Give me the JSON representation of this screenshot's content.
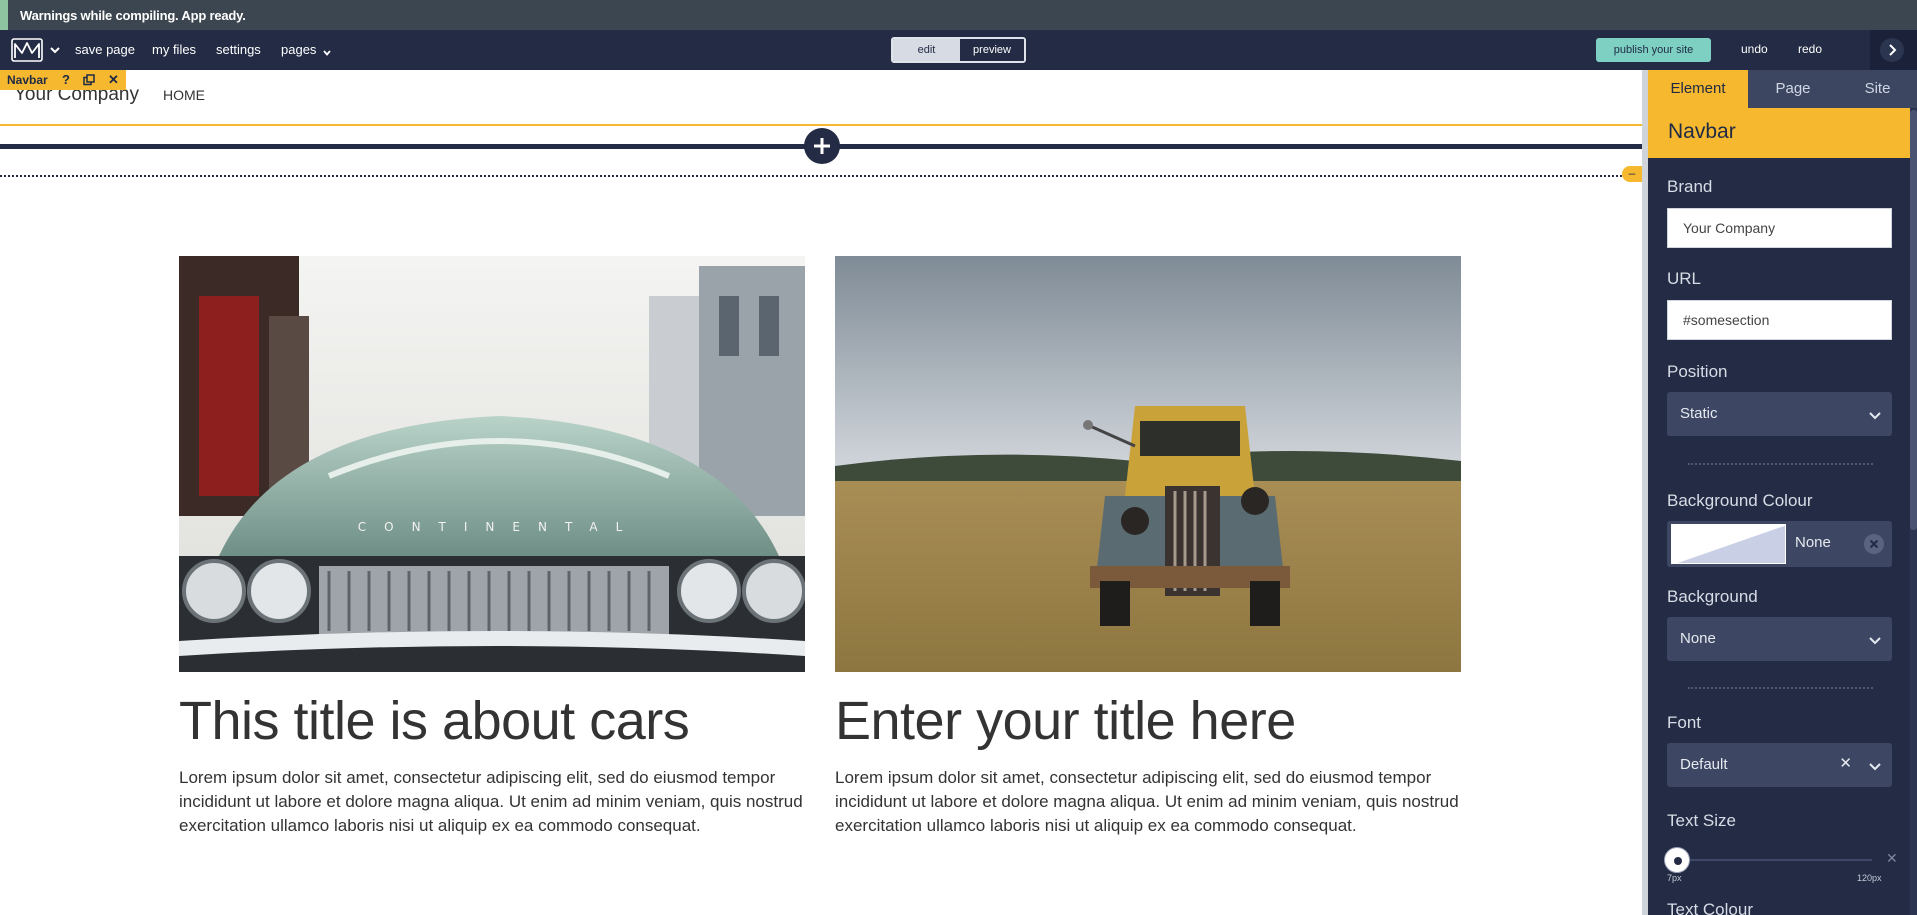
{
  "status": {
    "message": "Warnings while compiling. App ready."
  },
  "toolbar": {
    "logo_icon": "m-logo-icon",
    "links": {
      "save_page": "save page",
      "my_files": "my files",
      "settings": "settings",
      "pages": "pages"
    },
    "mode": {
      "edit": "edit",
      "preview": "preview",
      "active": "edit"
    },
    "publish": "publish your site",
    "undo": "undo",
    "redo": "redo"
  },
  "canvas": {
    "selected_tag": "Navbar",
    "tag_icons": [
      "help-icon",
      "duplicate-icon",
      "close-icon"
    ],
    "navbar": {
      "brand": "Your Company",
      "link": "HOME"
    },
    "add_section_icon": "plus-icon",
    "collapse_label": "–",
    "cards": [
      {
        "image": "vintage-continental-car-photo",
        "title": "This title is about cars",
        "body": "Lorem ipsum dolor sit amet, consectetur adipiscing elit, sed do eiusmod tempor incididunt ut labore et dolore magna aliqua. Ut enim ad minim veniam, quis nostrud exercitation ullamco laboris nisi ut aliquip ex ea commodo consequat."
      },
      {
        "image": "rusty-truck-in-field-photo",
        "title": "Enter your title here",
        "body": "Lorem ipsum dolor sit amet, consectetur adipiscing elit, sed do eiusmod tempor incididunt ut labore et dolore magna aliqua. Ut enim ad minim veniam, quis nostrud exercitation ullamco laboris nisi ut aliquip ex ea commodo consequat."
      }
    ]
  },
  "panel": {
    "tabs": [
      "Element",
      "Page",
      "Site"
    ],
    "active_tab": "Element",
    "header": "Navbar",
    "brand_label": "Brand",
    "brand_value": "Your Company",
    "url_label": "URL",
    "url_value": "#somesection",
    "position_label": "Position",
    "position_value": "Static",
    "bgcolour_label": "Background Colour",
    "bgcolour_value": "None",
    "background_label": "Background",
    "background_value": "None",
    "font_label": "Font",
    "font_value": "Default",
    "textsize_label": "Text Size",
    "textsize_min": "7px",
    "textsize_max": "120px",
    "textsize_level": 0,
    "textcolour_label": "Text Colour"
  },
  "colors": {
    "accent": "#f5b82e",
    "navy": "#232b45",
    "publish": "#7ed0c3"
  }
}
